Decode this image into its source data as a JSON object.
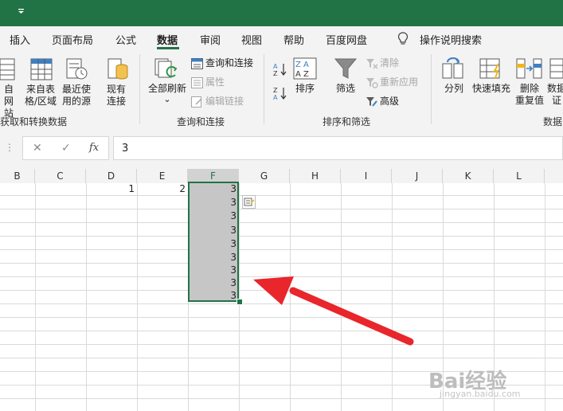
{
  "title_bar": {
    "qat_icon": "customize-dropdown-icon"
  },
  "menu": {
    "tabs": [
      "插入",
      "页面布局",
      "公式",
      "数据",
      "审阅",
      "视图",
      "帮助",
      "百度网盘"
    ],
    "active_tab": "数据",
    "tell_me_icon": "lightbulb-icon",
    "tell_me": "操作说明搜索"
  },
  "ribbon": {
    "get_data": {
      "from_web": "自\n网站",
      "from_table": "来自表\n格/区域",
      "recent_sources": "最近使\n用的源",
      "existing": "现有\n连接",
      "group": "获取和转换数据"
    },
    "queries": {
      "refresh_all": "全部刷新",
      "refresh_dropdown": "⌄",
      "queries_connections": "查询和连接",
      "properties": "属性",
      "edit_links": "编辑链接",
      "group": "查询和连接"
    },
    "sort_filter": {
      "sort": "排序",
      "filter": "筛选",
      "clear": "清除",
      "reapply": "重新应用",
      "advanced": "高级",
      "group": "排序和筛选"
    },
    "data_tools": {
      "text_to_columns": "分列",
      "flash_fill": "快速填充",
      "remove_duplicates": "删除\n重复值",
      "validation": "数据\n证",
      "group": "数据"
    }
  },
  "formula_bar": {
    "cancel": "✕",
    "enter": "✓",
    "fx": "fx",
    "value": "3"
  },
  "sheet": {
    "columns": [
      "B",
      "C",
      "D",
      "E",
      "F",
      "G",
      "H",
      "I",
      "J",
      "K",
      "L"
    ],
    "selected_column": "F",
    "values": {
      "D1": "1",
      "E1": "2"
    },
    "f_column_values": [
      "3",
      "3",
      "3",
      "3",
      "3",
      "3",
      "3",
      "3",
      "3"
    ]
  },
  "annotation": {
    "arrow_color": "#e8262b"
  },
  "watermark": {
    "text": "Bai经验",
    "url": "jingyan.baidu.com"
  },
  "colors": {
    "brand": "#217346",
    "selection": "#c6c6c6"
  }
}
